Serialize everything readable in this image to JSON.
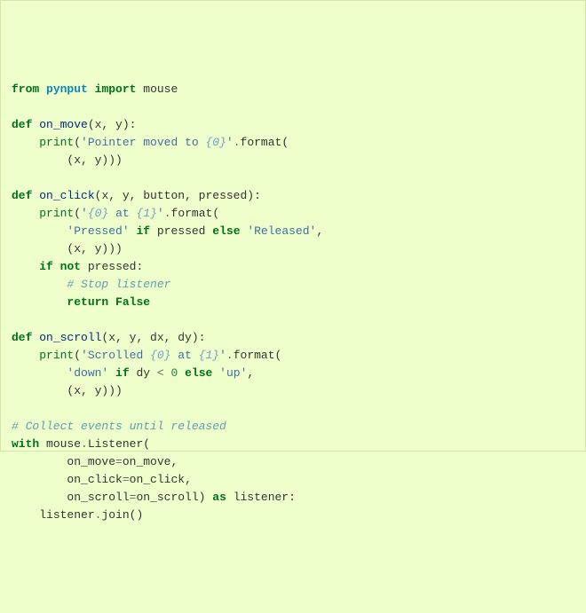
{
  "code": {
    "kw_from": "from",
    "mod_pynput": "pynput",
    "kw_import": "import",
    "name_mouse": "mouse",
    "kw_def1": "def",
    "fn_on_move": "on_move",
    "params_xy": "(x, y):",
    "print1": "print",
    "lp1": "(",
    "s1a": "'Pointer moved to ",
    "s1b": "{0}",
    "s1c": "'",
    "dot1": ".",
    "fmt1": "format(",
    "xy_close1": "(x, y)))",
    "kw_def2": "def",
    "fn_on_click": "on_click",
    "params_click": "(x, y, button, pressed):",
    "print2": "print",
    "lp2": "(",
    "s2a": "'",
    "s2b": "{0}",
    "s2c": " at ",
    "s2d": "{1}",
    "s2e": "'",
    "dot2": ".",
    "fmt2": "format(",
    "s_pressed": "'Pressed'",
    "kw_if1": "if",
    "name_pressed": "pressed",
    "kw_else1": "else",
    "s_released": "'Released'",
    "comma1": ",",
    "xy_close2": "(x, y)))",
    "kw_if2": "if",
    "kw_not": "not",
    "name_pressed2": "pressed:",
    "comment_stop": "# Stop listener",
    "kw_return": "return",
    "kw_false": "False",
    "kw_def3": "def",
    "fn_on_scroll": "on_scroll",
    "params_scroll": "(x, y, dx, dy):",
    "print3": "print",
    "lp3": "(",
    "s3a": "'Scrolled ",
    "s3b": "{0}",
    "s3c": " at ",
    "s3d": "{1}",
    "s3e": "'",
    "dot3": ".",
    "fmt3": "format(",
    "s_down": "'down'",
    "kw_if3": "if",
    "name_dy": "dy",
    "op_lt": "<",
    "num_zero": "0",
    "kw_else2": "else",
    "s_up": "'up'",
    "comma2": ",",
    "xy_close3": "(x, y)))",
    "comment_collect": "# Collect events until released",
    "kw_with": "with",
    "name_mouse2": "mouse",
    "dot4": ".",
    "cls_listener": "Listener(",
    "arg_move": "on_move",
    "eq1": "=",
    "val_move": "on_move,",
    "arg_click": "on_click",
    "eq2": "=",
    "val_click": "on_click,",
    "arg_scroll": "on_scroll",
    "eq3": "=",
    "val_scroll": "on_scroll)",
    "kw_as": "as",
    "name_listener": "listener:",
    "name_listener2": "listener",
    "dot5": ".",
    "fn_join": "join()"
  }
}
